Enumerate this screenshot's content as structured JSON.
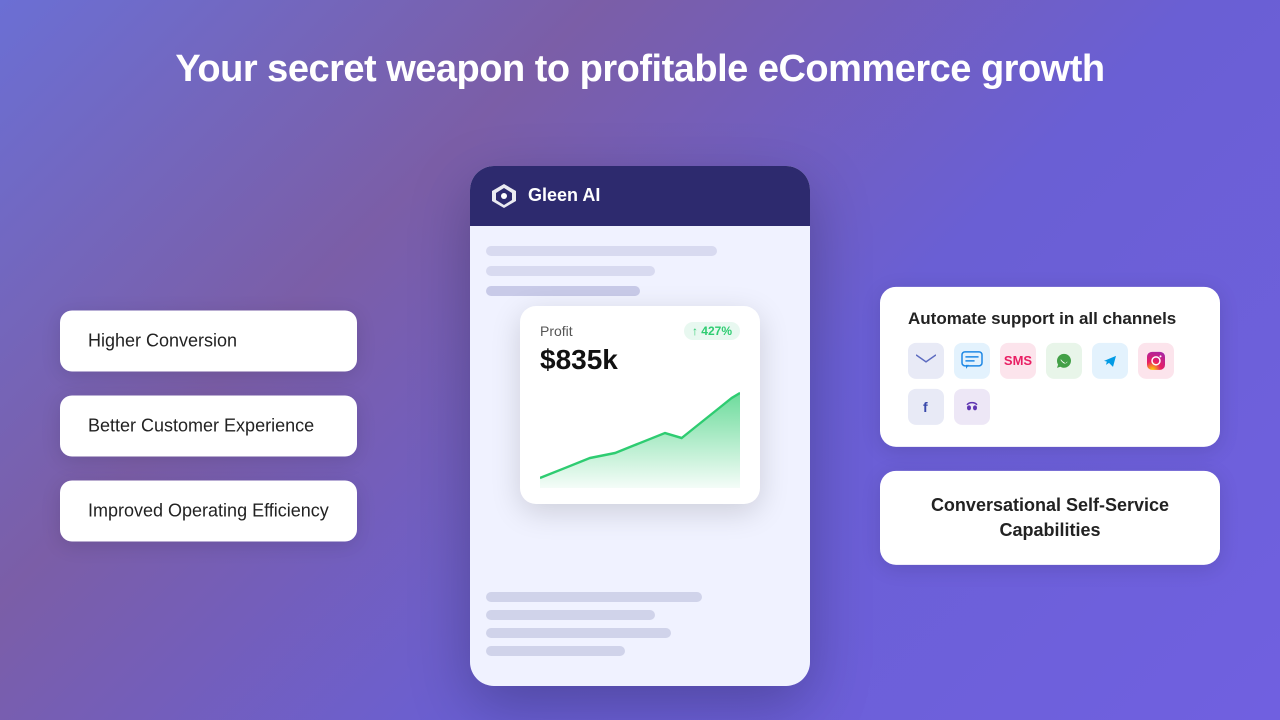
{
  "page": {
    "title": "Your secret weapon to profitable eCommerce growth"
  },
  "left_features": [
    {
      "id": "higher-conversion",
      "label": "Higher Conversion"
    },
    {
      "id": "better-customer-experience",
      "label": "Better Customer Experience"
    },
    {
      "id": "improved-operating-efficiency",
      "label": "Improved Operating Efficiency"
    }
  ],
  "center": {
    "brand": "Gleen AI",
    "profit_label": "Profit",
    "profit_badge": "↑ 427%",
    "profit_value": "$835k"
  },
  "right_cards": [
    {
      "id": "automate-support",
      "title": "Automate support in all channels",
      "channels": [
        {
          "id": "email",
          "label": "✉",
          "color_class": "ch-email"
        },
        {
          "id": "chat",
          "label": "💬",
          "color_class": "ch-chat"
        },
        {
          "id": "sms",
          "label": "💬",
          "color_class": "ch-sms"
        },
        {
          "id": "whatsapp",
          "label": "📱",
          "color_class": "ch-whatsapp"
        },
        {
          "id": "telegram",
          "label": "✈",
          "color_class": "ch-telegram"
        },
        {
          "id": "instagram",
          "label": "📷",
          "color_class": "ch-instagram"
        },
        {
          "id": "facebook",
          "label": "f",
          "color_class": "ch-facebook"
        },
        {
          "id": "discord",
          "label": "⊕",
          "color_class": "ch-discord"
        }
      ]
    },
    {
      "id": "conversational-self-service",
      "title": "Conversational Self-Service Capabilities"
    }
  ]
}
